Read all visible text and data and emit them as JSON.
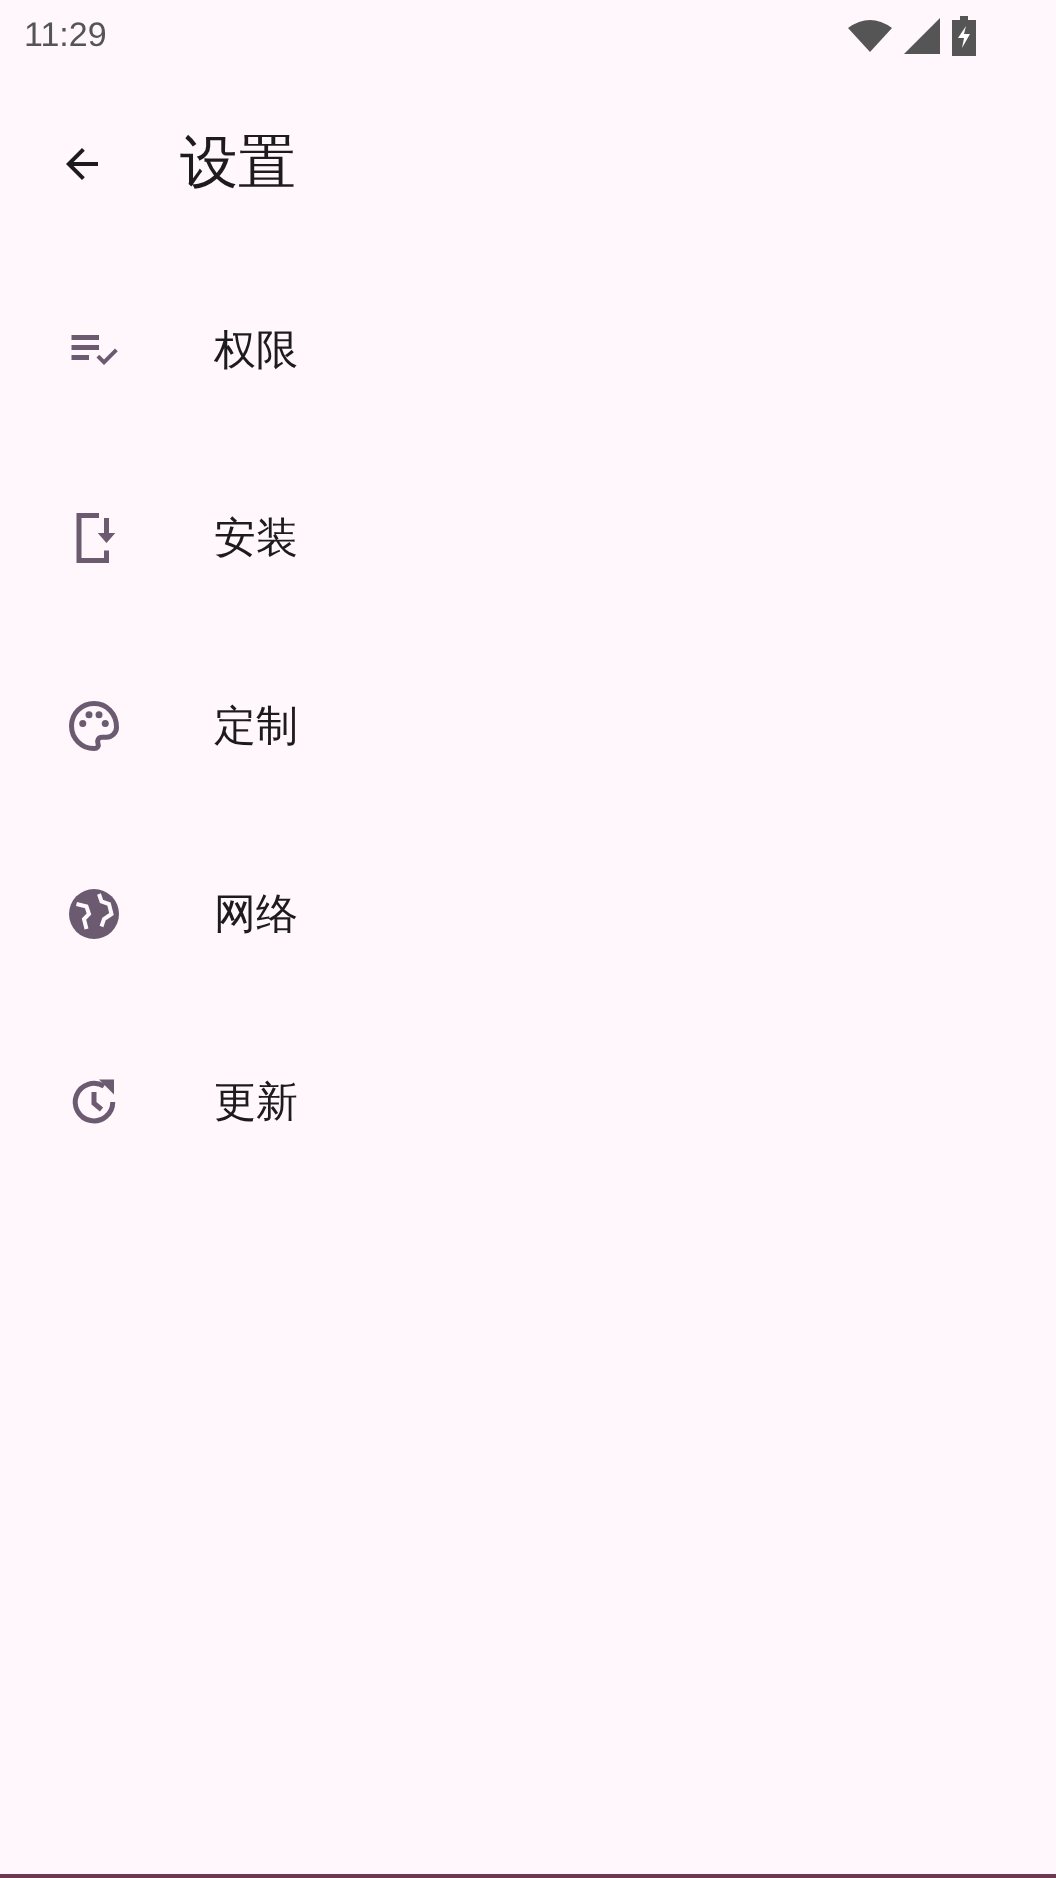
{
  "status_bar": {
    "time": "11:29"
  },
  "toolbar": {
    "title": "设置"
  },
  "items": [
    {
      "label": "权限"
    },
    {
      "label": "安装"
    },
    {
      "label": "定制"
    },
    {
      "label": "网络"
    },
    {
      "label": "更新"
    }
  ]
}
